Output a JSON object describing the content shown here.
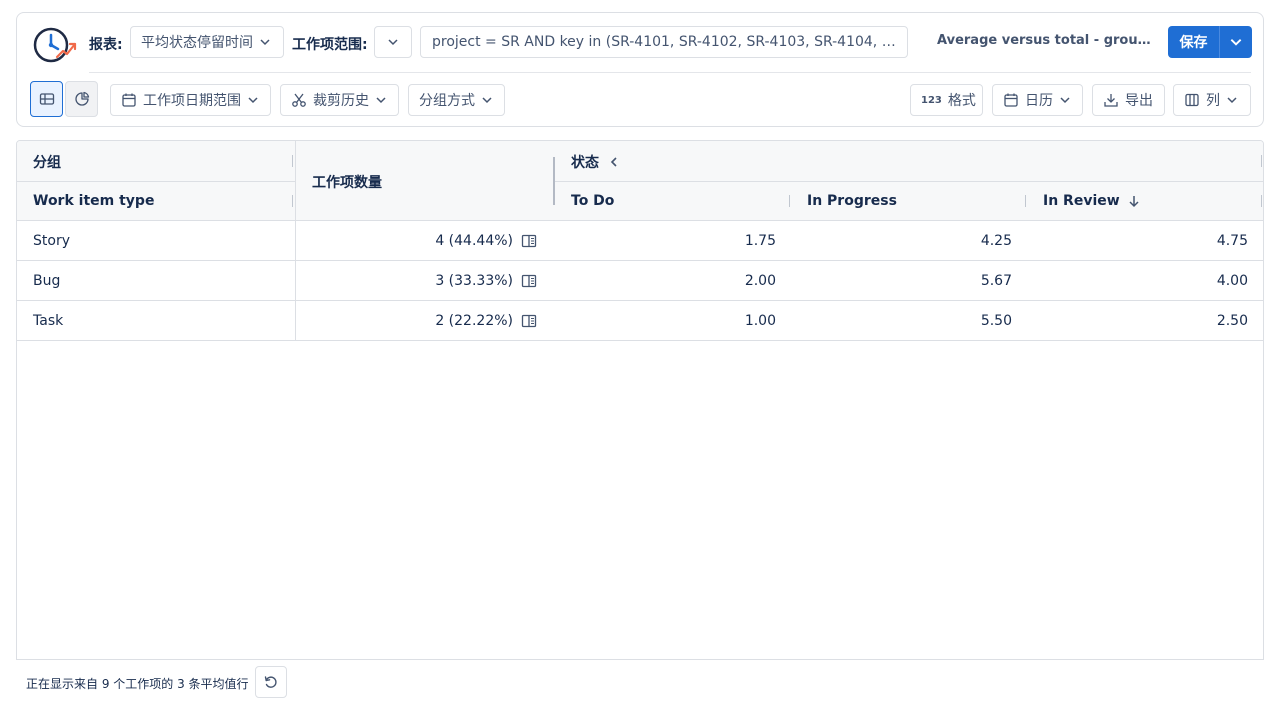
{
  "toolbar": {
    "report_label": "报表:",
    "report_value": "平均状态停留时间",
    "scope_label": "工作项范围:",
    "jql": "project = SR AND key in (SR-4101, SR-4102, SR-4103, SR-4104, SR-4105, SR-4106, SR-4107, SR-4108, SR-4109)",
    "report_name": "Average versus total - grouped a...",
    "save_label": "保存",
    "date_range_label": "工作项日期范围",
    "trim_history_label": "裁剪历史",
    "group_by_label": "分组方式",
    "format_label": "格式",
    "format_icon_text": "123",
    "calendar_label": "日历",
    "export_label": "导出",
    "columns_label": "列"
  },
  "table": {
    "group_header": "分组",
    "group_sub_header": "Work item type",
    "count_header": "工作项数量",
    "status_header": "状态",
    "status_columns": [
      "To Do",
      "In Progress",
      "In Review"
    ],
    "rows": [
      {
        "type": "Story",
        "count": "4 (44.44%)",
        "values": [
          "1.75",
          "4.25",
          "4.75"
        ]
      },
      {
        "type": "Bug",
        "count": "3 (33.33%)",
        "values": [
          "2.00",
          "5.67",
          "4.00"
        ]
      },
      {
        "type": "Task",
        "count": "2 (22.22%)",
        "values": [
          "1.00",
          "5.50",
          "2.50"
        ]
      }
    ]
  },
  "footer": {
    "summary": "正在显示来自 9 个工作项的 3 条平均值行"
  },
  "colors": {
    "accent": "#1f6ed4",
    "border": "#dcdfe4",
    "text": "#172b4d"
  }
}
